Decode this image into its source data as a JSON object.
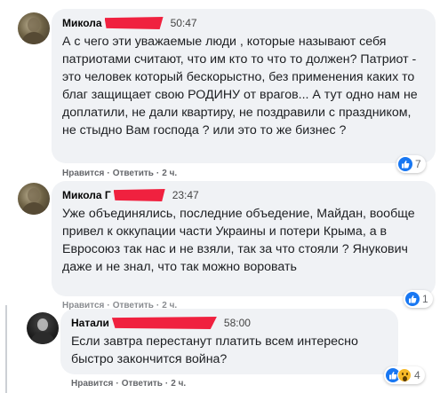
{
  "comments": [
    {
      "author": "Микола",
      "time": "50:47",
      "text": "А с чего эти уважаемые люди , которые называют себя патриотами считают, что им кто то что то должен? Патриот - это человек который бескорыстно, без применения каких то благ защищает свою РОДИНУ от врагов... А тут одно нам не доплатили, не дали квартиру, не поздравили с праздником, не стыдно Вам господа ? или это то же бизнес ?",
      "actions": {
        "like": "Нравится",
        "reply": "Ответить",
        "age": "2 ч."
      },
      "reactions": {
        "count": "7",
        "icons": [
          "like-icon"
        ]
      }
    },
    {
      "author": "Микола Г",
      "time": "23:47",
      "text": "Уже объединялись, последние объедение, Майдан, вообще привел к оккупации части Украины и потери Крыма, а в Евросоюз так нас и не взяли, так за что стояли ? Янукович даже и не знал, что так можно воровать",
      "actions": {
        "like": "Нравится",
        "reply": "Ответить",
        "age": "2 ч."
      },
      "reactions": {
        "count": "1",
        "icons": [
          "like-icon"
        ]
      }
    },
    {
      "author": "Натали",
      "time": "58:00",
      "text": "Если завтра перестанут платить всем интересно быстро закончится война?",
      "actions": {
        "like": "Нравится",
        "reply": "Ответить",
        "age": "2 ч."
      },
      "reactions": {
        "count": "4",
        "icons": [
          "like-icon",
          "wow-icon"
        ]
      }
    }
  ],
  "colors": {
    "bubble": "#f0f2f5",
    "redaction": "#f0213f",
    "like_blue": "#1877f2",
    "wow_yellow": "#f7b928"
  }
}
